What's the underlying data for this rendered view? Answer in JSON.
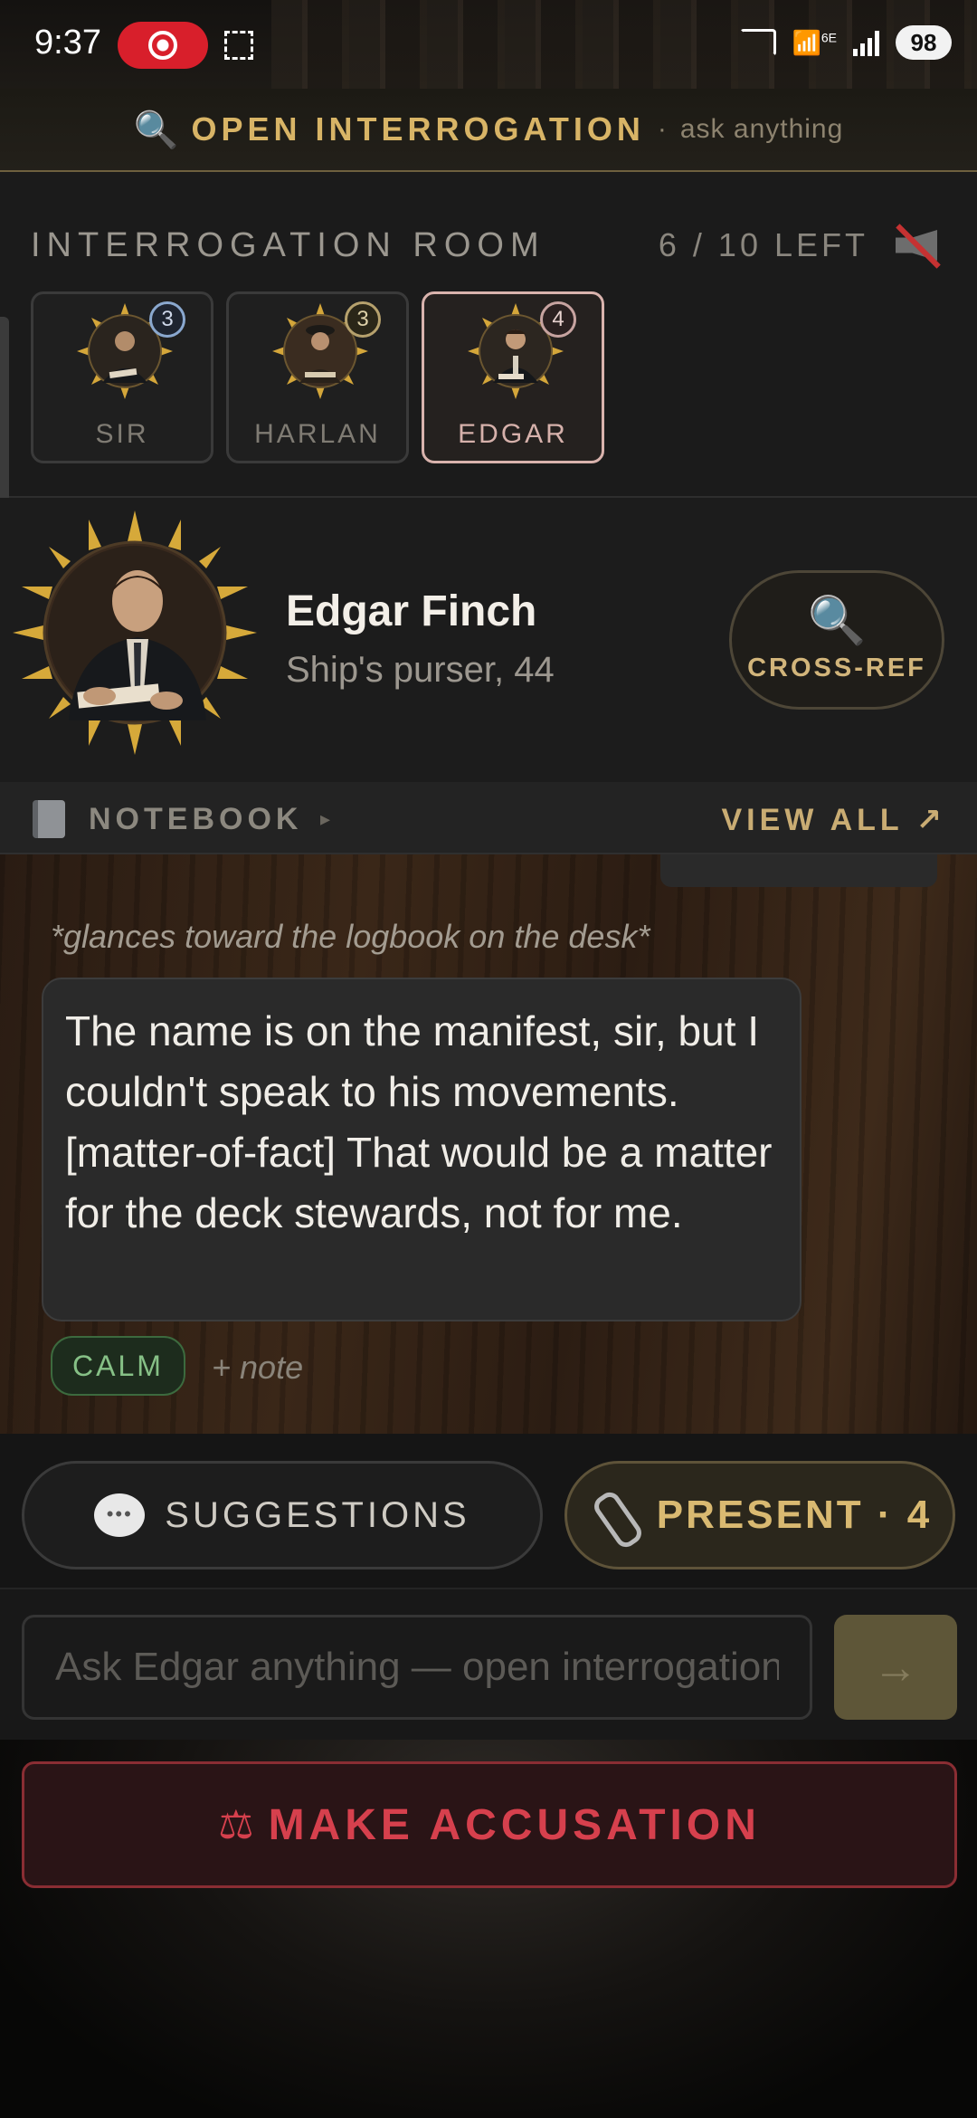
{
  "status_bar": {
    "time": "9:37",
    "network": "6E",
    "battery": "98"
  },
  "banner": {
    "title": "OPEN INTERROGATION",
    "separator": "·",
    "subtitle": "ask anything"
  },
  "room": {
    "title": "INTERROGATION ROOM",
    "questions_left": "6 / 10 LEFT",
    "suspects": [
      {
        "label": "SIR",
        "count": "3"
      },
      {
        "label": "HARLAN",
        "count": "3"
      },
      {
        "label": "EDGAR",
        "count": "4"
      }
    ]
  },
  "profile": {
    "name": "Edgar Finch",
    "role": "Ship's purser, 44",
    "crossref_label": "CROSS-REF"
  },
  "notebook": {
    "title": "NOTEBOOK",
    "caret": "▸",
    "view_all": "VIEW ALL ↗"
  },
  "chat": {
    "action": "*glances toward the logbook on the desk*",
    "message": "The name is on the manifest, sir, but I couldn't speak to his movements. [matter-of-fact] That would be a matter for the deck stewards, not for me.",
    "mood": "CALM",
    "add_note": "+ note"
  },
  "actions": {
    "suggestions_label": "SUGGESTIONS",
    "present_label": "PRESENT · 4"
  },
  "input": {
    "placeholder": "Ask Edgar anything — open interrogation",
    "send_icon": "→"
  },
  "accuse": {
    "icon": "⚖",
    "label": "MAKE ACCUSATION"
  },
  "colors": {
    "gold": "#d8b466",
    "accuse_red": "#d6404d",
    "calm_green": "#86c086",
    "active_card": "#d9b3ad"
  }
}
